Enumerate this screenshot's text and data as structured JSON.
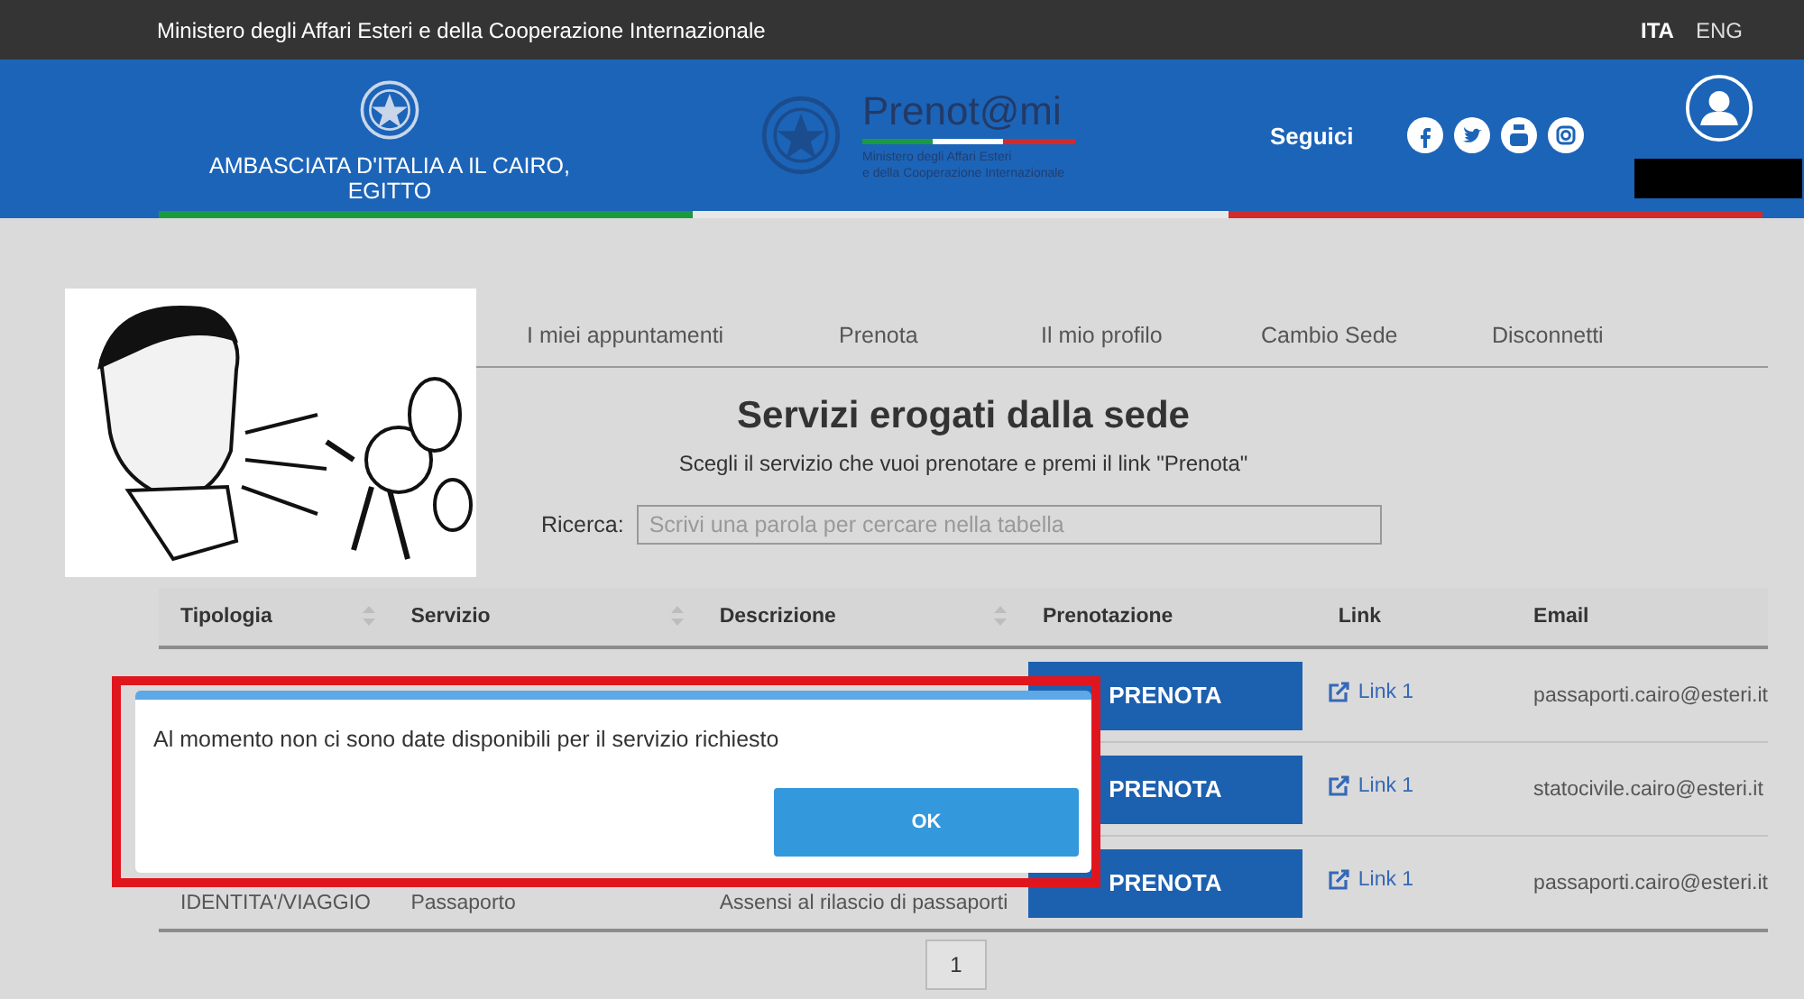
{
  "top_bar": {
    "ministry": "Ministero degli Affari Esteri e della Cooperazione Internazionale",
    "languages": [
      {
        "label": "ITA",
        "selected": true
      },
      {
        "label": "ENG",
        "selected": false
      }
    ]
  },
  "header": {
    "office": "AMBASCIATA D'ITALIA A IL CAIRO, EGITTO",
    "logo": {
      "name": "Prenot@mi",
      "subtitle": [
        "Ministero degli Affari Esteri",
        "e della Cooperazione Internazionale"
      ]
    },
    "follow": "Seguici"
  },
  "nav": {
    "items": [
      "I miei appuntamenti",
      "Prenota",
      "Il mio profilo",
      "Cambio Sede",
      "Disconnetti"
    ]
  },
  "title": "Servizi erogati dalla sede",
  "subtitle": "Scegli il servizio che vuoi prenotare e premi il link \"Prenota\"",
  "search": {
    "label": "Ricerca:",
    "placeholder": "Scrivi una parola per cercare nella tabella"
  },
  "table": {
    "columns": [
      {
        "label": "Tipologia",
        "sortable": true
      },
      {
        "label": "Servizio",
        "sortable": true
      },
      {
        "label": "Descrizione",
        "sortable": true
      },
      {
        "label": "Prenotazione",
        "sortable": false
      },
      {
        "label": "Link",
        "sortable": false
      },
      {
        "label": "Email",
        "sortable": false
      }
    ],
    "rows": [
      {
        "action": "PRENOTA",
        "link": "Link 1",
        "email": "passaporti.cairo@esteri.it"
      },
      {
        "action": "PRENOTA",
        "link": "Link 1",
        "email": "statocivile.cairo@esteri.it"
      },
      {
        "tipologia": "IDENTITA'/VIAGGIO",
        "servizio": "Passaporto",
        "descrizione": "Assensi al rilascio di passaporti",
        "action": "PRENOTA",
        "link": "Link 1",
        "email": "passaporti.cairo@esteri.it"
      }
    ]
  },
  "pages": [
    "1"
  ],
  "dialog": {
    "message": "Al momento non ci sono date disponibili per il servizio richiesto",
    "button": "OK"
  }
}
